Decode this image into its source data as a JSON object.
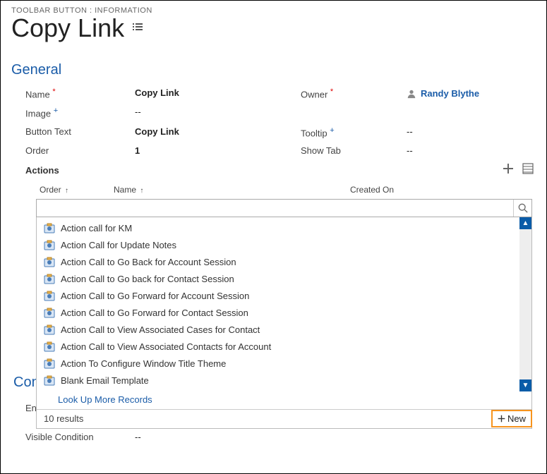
{
  "breadcrumb": "TOOLBAR BUTTON : INFORMATION",
  "page_title": "Copy Link",
  "section_general": "General",
  "fields": {
    "name": {
      "label": "Name",
      "value": "Copy Link"
    },
    "owner": {
      "label": "Owner",
      "value": "Randy Blythe"
    },
    "image": {
      "label": "Image",
      "value": "--"
    },
    "button_text": {
      "label": "Button Text",
      "value": "Copy Link"
    },
    "tooltip": {
      "label": "Tooltip",
      "value": "--"
    },
    "order": {
      "label": "Order",
      "value": "1"
    },
    "show_tab": {
      "label": "Show Tab",
      "value": "--"
    },
    "visible_condition": {
      "label": "Visible Condition",
      "value": "--"
    }
  },
  "actions_label": "Actions",
  "grid_headers": {
    "order": "Order",
    "name": "Name",
    "created_on": "Created On"
  },
  "dropdown_items": [
    "Action call for KM",
    "Action Call for Update Notes",
    "Action Call to Go Back for Account Session",
    "Action Call to Go back for Contact Session",
    "Action Call to Go Forward for Account Session",
    "Action Call to Go Forward for Contact Session",
    "Action Call to View Associated Cases for Contact",
    "Action Call to View Associated Contacts for Account",
    "Action To Configure Window Title Theme",
    "Blank Email Template"
  ],
  "lookup_more": "Look Up More Records",
  "results_text": "10 results",
  "new_label": "New",
  "behind_section": "Con",
  "behind_field": "En"
}
